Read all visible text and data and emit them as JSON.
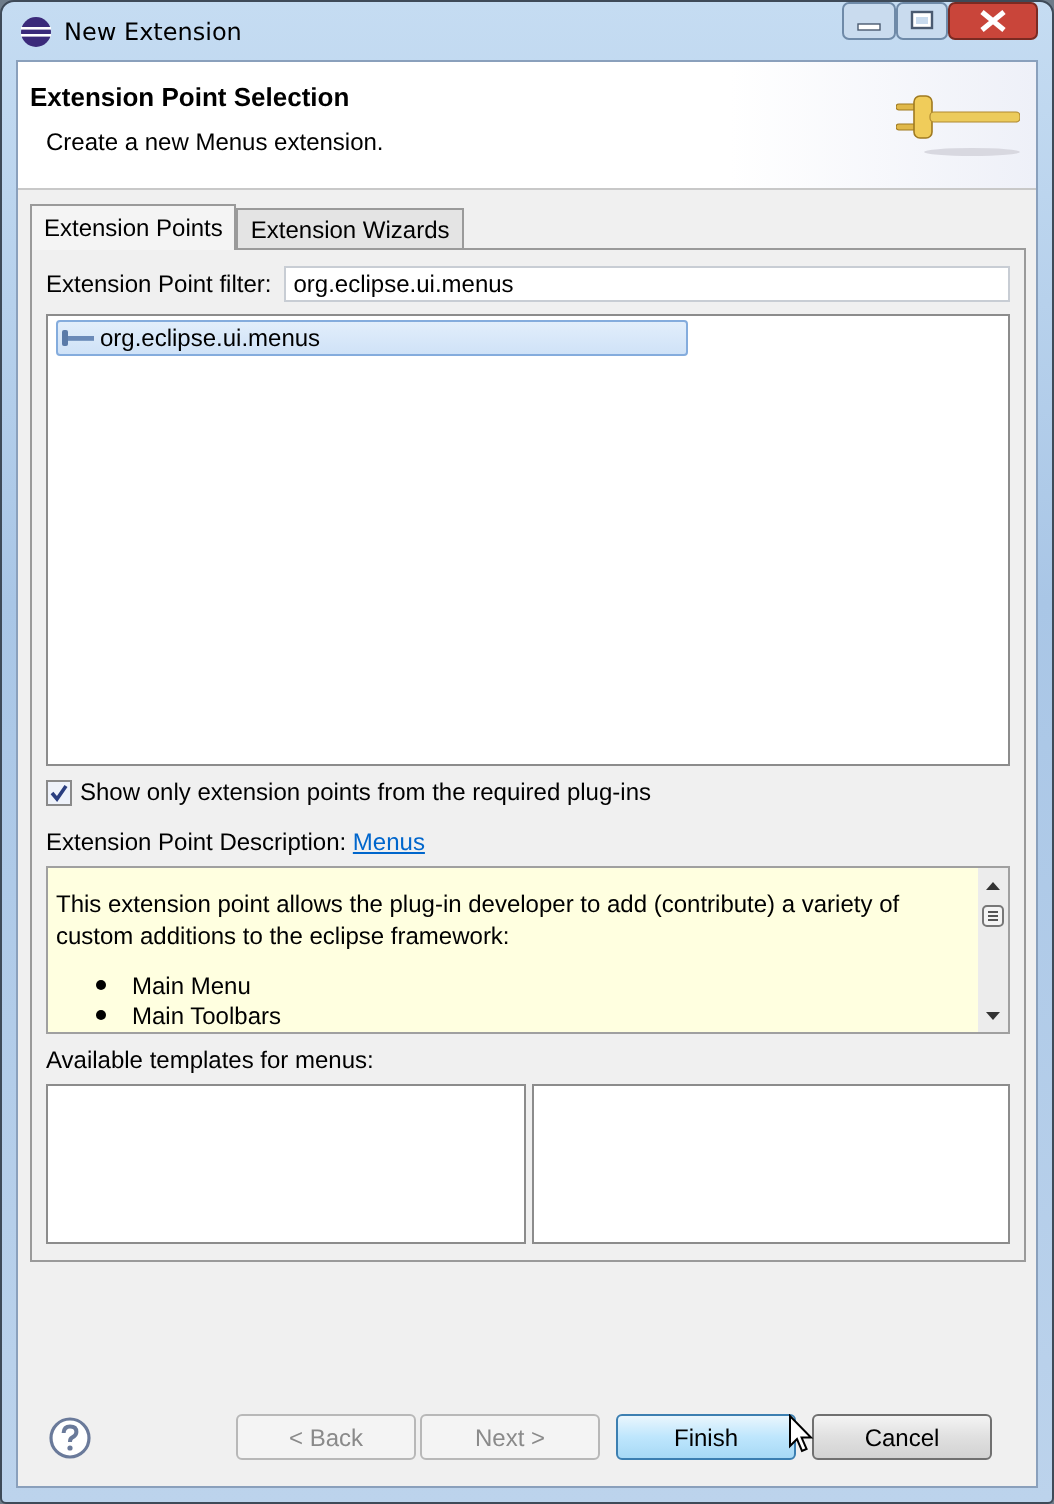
{
  "window": {
    "title": "New Extension"
  },
  "header": {
    "title": "Extension Point Selection",
    "message": "Create a new Menus extension."
  },
  "tabs": [
    {
      "label": "Extension Points",
      "selected": true
    },
    {
      "label": "Extension Wizards",
      "selected": false
    }
  ],
  "filter": {
    "label": "Extension Point filter:",
    "value": "org.eclipse.ui.menus"
  },
  "extension_points": [
    {
      "label": "org.eclipse.ui.menus",
      "selected": true
    }
  ],
  "show_only_required": {
    "label": "Show only extension points from the required plug-ins",
    "checked": true
  },
  "description": {
    "label": "Extension Point Description:",
    "link": "Menus",
    "text": "This extension point allows the plug-in developer to add (contribute) a variety of custom additions to the eclipse framework:",
    "bullets": [
      "Main Menu",
      "Main Toolbars"
    ]
  },
  "templates": {
    "label": "Available templates for menus:"
  },
  "buttons": [
    {
      "label": "< Back",
      "disabled": true,
      "default": false
    },
    {
      "label": "Next >",
      "disabled": true,
      "default": false
    },
    {
      "label": "Finish",
      "disabled": false,
      "default": true
    },
    {
      "label": "Cancel",
      "disabled": false,
      "default": false
    }
  ]
}
